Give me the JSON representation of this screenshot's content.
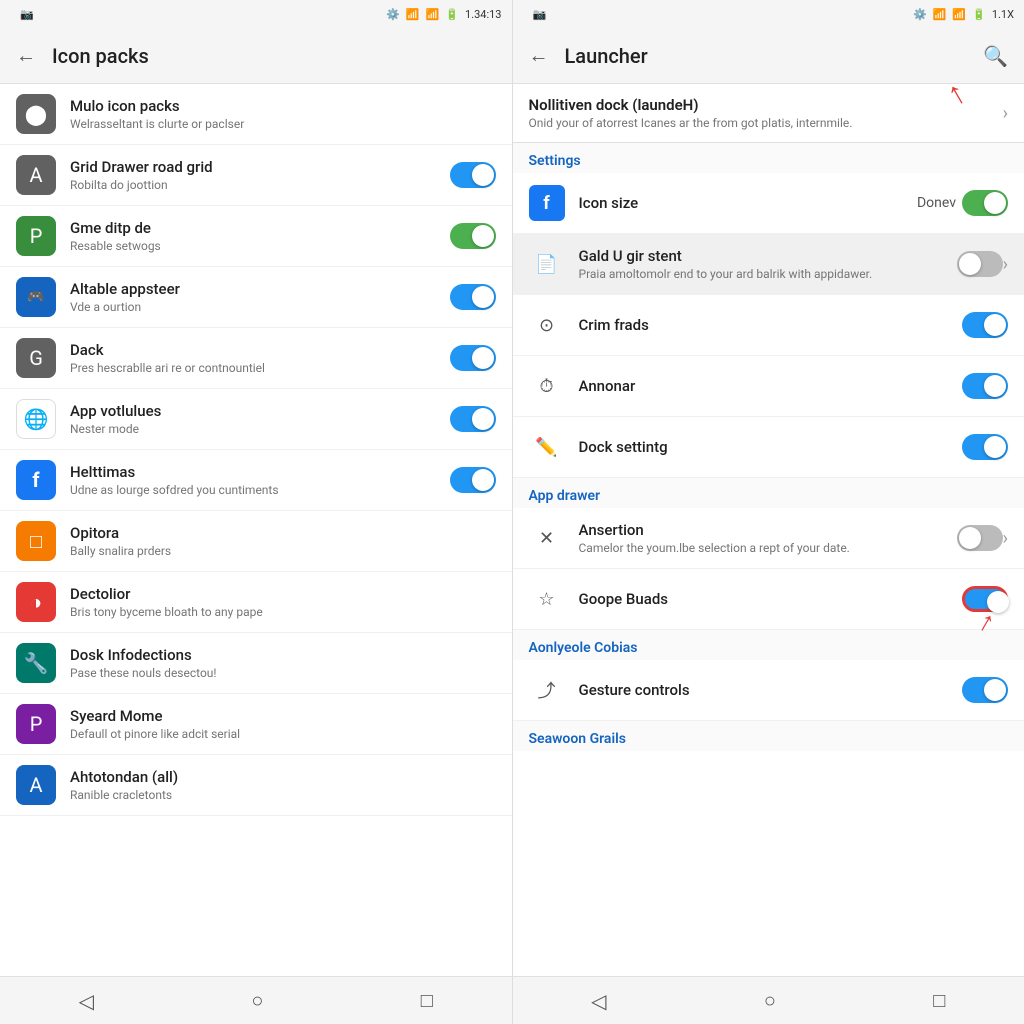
{
  "left_panel": {
    "status_bar": {
      "left_icons": "📷",
      "time": "1.34:13",
      "right_icons": "⚙️ 📶 📶 🔋"
    },
    "toolbar": {
      "back_icon": "←",
      "title": "Icon packs"
    },
    "items": [
      {
        "icon": "⬤",
        "icon_class": "icon-grey",
        "title": "Mulo icon packs",
        "subtitle": "Welrasseltant is clurte or paclser",
        "has_toggle": false
      },
      {
        "icon": "A",
        "icon_class": "icon-grey",
        "title": "Grid Drawer road grid",
        "subtitle": "Robilta do joottion",
        "has_toggle": true,
        "toggle_state": "on"
      },
      {
        "icon": "P",
        "icon_class": "icon-green",
        "title": "Gme ditp de",
        "subtitle": "Resable setwogs",
        "has_toggle": true,
        "toggle_state": "on-green"
      },
      {
        "icon": "🎮",
        "icon_class": "icon-blue",
        "title": "Altable appsteer",
        "subtitle": "Vde a ourtion",
        "has_toggle": true,
        "toggle_state": "on"
      },
      {
        "icon": "G",
        "icon_class": "icon-grey",
        "title": "Dack",
        "subtitle": "Pres hescrablle ari re or contnountiel",
        "has_toggle": true,
        "toggle_state": "on"
      },
      {
        "icon": "🌐",
        "icon_class": "icon-chrome",
        "title": "App votlulues",
        "subtitle": "Nester mode",
        "has_toggle": true,
        "toggle_state": "on"
      },
      {
        "icon": "f",
        "icon_class": "icon-fb",
        "title": "Helttimas",
        "subtitle": "Udne as lourge sofdred you cuntiments",
        "has_toggle": true,
        "toggle_state": "on"
      },
      {
        "icon": "□",
        "icon_class": "icon-orange",
        "title": "Opitora",
        "subtitle": "Bally snalira prders",
        "has_toggle": false
      },
      {
        "icon": "◑",
        "icon_class": "icon-red",
        "title": "Dectolior",
        "subtitle": "Bris tony byceme bloath to any pape",
        "has_toggle": false
      },
      {
        "icon": "🔧",
        "icon_class": "icon-teal",
        "title": "Dosk Infodections",
        "subtitle": "Pase these nouls desectou!",
        "has_toggle": false
      },
      {
        "icon": "P",
        "icon_class": "icon-purple",
        "title": "Syeard Mome",
        "subtitle": "Defaull ot pinore like adcit serial",
        "has_toggle": false
      },
      {
        "icon": "A",
        "icon_class": "icon-blue",
        "title": "Ahtotondan (all)",
        "subtitle": "Ranible cracletonts",
        "has_toggle": false
      }
    ],
    "nav": {
      "back": "◁",
      "home": "○",
      "recent": "□"
    }
  },
  "right_panel": {
    "status_bar": {
      "left_icons": "📷",
      "right_icons": "⚙️ 📶 📶 🔋 1.1X"
    },
    "toolbar": {
      "back_icon": "←",
      "title": "Launcher",
      "search_icon": "🔍"
    },
    "top_banner": {
      "title": "Nollitiven dock (laundeH)",
      "subtitle": "Onid your of atorrest Icanes ar the from got platis, internmile."
    },
    "settings_section": {
      "label": "Settings",
      "items": [
        {
          "icon": "f",
          "icon_class": "icon-fb",
          "title": "Icon size",
          "subtitle": "",
          "value": "Donev",
          "has_toggle": true,
          "toggle_state": "on-green",
          "has_chevron": false
        },
        {
          "icon": "📄",
          "icon_class": "",
          "title": "Gald U gir stent",
          "subtitle": "Praia amoltomolr end to your ard balrik with appidawer.",
          "value": "",
          "has_toggle": false,
          "toggle_state": "off",
          "has_chevron": true,
          "highlighted": true
        },
        {
          "icon": "⊙",
          "icon_class": "",
          "title": "Crim frads",
          "subtitle": "",
          "value": "",
          "has_toggle": true,
          "toggle_state": "on",
          "has_chevron": false
        },
        {
          "icon": "⏱",
          "icon_class": "",
          "title": "Annonar",
          "subtitle": "",
          "value": "",
          "has_toggle": true,
          "toggle_state": "on",
          "has_chevron": false
        },
        {
          "icon": "✏️",
          "icon_class": "",
          "title": "Dock settintg",
          "subtitle": "",
          "value": "",
          "has_toggle": true,
          "toggle_state": "on",
          "has_chevron": false
        }
      ]
    },
    "app_drawer_section": {
      "label": "App drawer",
      "items": [
        {
          "icon": "✕",
          "icon_class": "",
          "title": "Ansertion",
          "subtitle": "Camelor the youm.lbe selection a rept of your date.",
          "value": "",
          "has_toggle": false,
          "toggle_state": "off",
          "has_chevron": true
        },
        {
          "icon": "☆",
          "icon_class": "",
          "title": "Goope Buads",
          "subtitle": "",
          "value": "",
          "has_toggle": true,
          "toggle_state": "on",
          "has_chevron": false,
          "highlighted_toggle": true
        }
      ]
    },
    "aonlyeole_section": {
      "label": "Aonlyeole Cobias",
      "items": [
        {
          "icon": "⤴",
          "icon_class": "",
          "title": "Gesture controls",
          "subtitle": "",
          "value": "",
          "has_toggle": true,
          "toggle_state": "on",
          "has_chevron": false
        }
      ]
    },
    "seawoon_section": {
      "label": "Seawoon Grails"
    },
    "nav": {
      "back": "◁",
      "home": "○",
      "recent": "□"
    }
  }
}
